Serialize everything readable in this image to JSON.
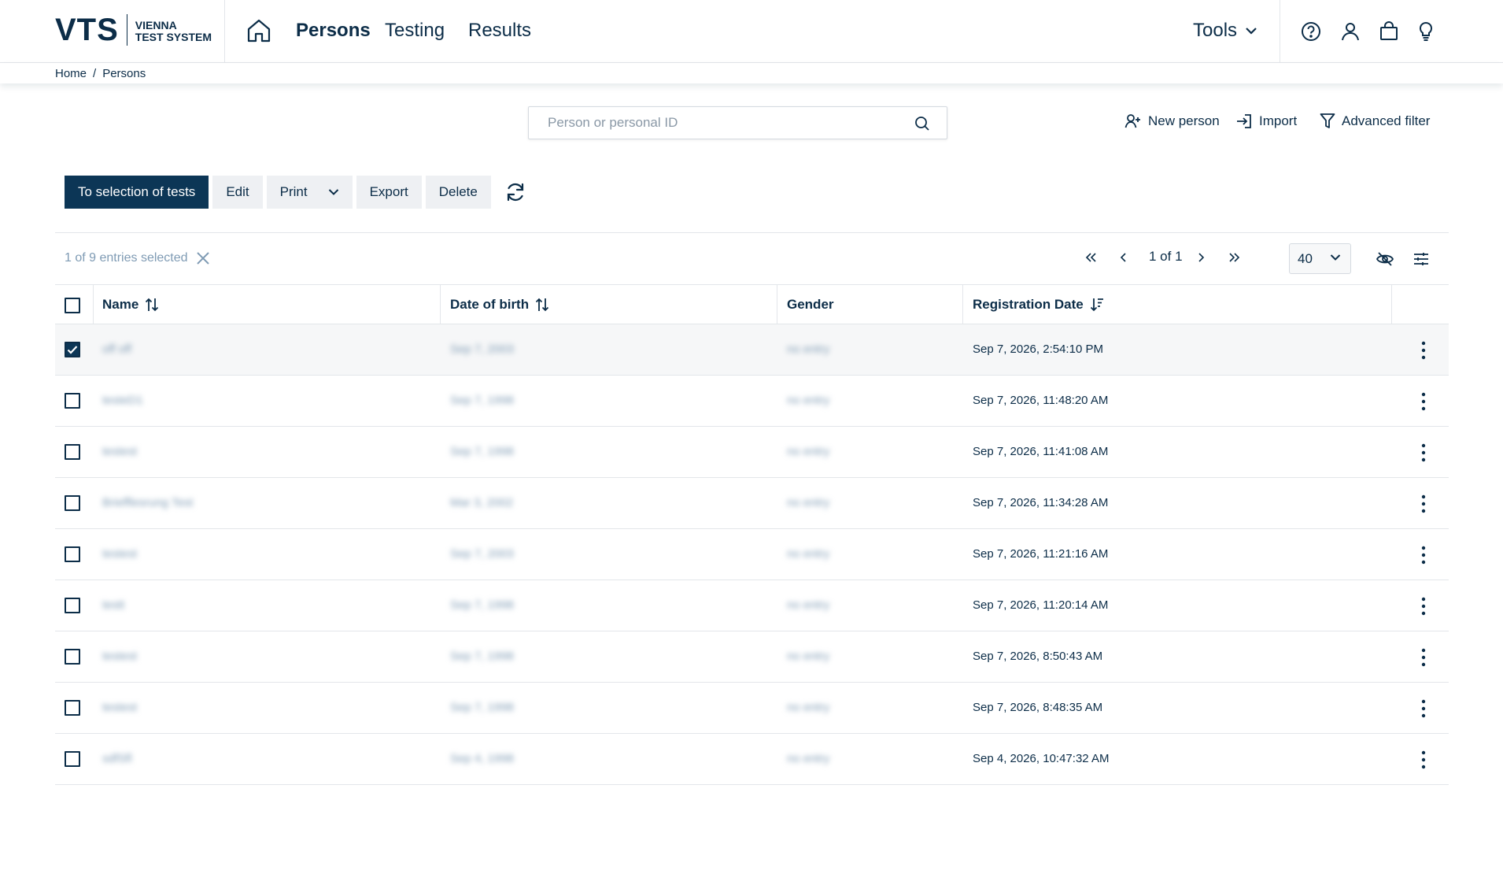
{
  "logo": {
    "mark": "VTS",
    "line1": "VIENNA",
    "line2": "TEST SYSTEM"
  },
  "nav": {
    "persons": "Persons",
    "testing": "Testing",
    "results": "Results",
    "tools": "Tools"
  },
  "breadcrumb": {
    "home": "Home",
    "sep": "/",
    "current": "Persons"
  },
  "search": {
    "placeholder": "Person or personal ID"
  },
  "actions": {
    "new_person": "New person",
    "import": "Import",
    "advanced_filter": "Advanced filter"
  },
  "toolbar": {
    "to_selection": "To selection of tests",
    "edit": "Edit",
    "print": "Print",
    "export": "Export",
    "delete": "Delete"
  },
  "selection": {
    "text": "1 of 9 entries selected"
  },
  "pager": {
    "text": "1 of 1",
    "page_size": "40"
  },
  "table": {
    "headers": {
      "name": "Name",
      "dob": "Date of birth",
      "gender": "Gender",
      "registration": "Registration Date"
    },
    "rows": [
      {
        "name": "off off",
        "dob": "Sep 7, 2003",
        "gender": "no entry",
        "registration": "Sep 7, 2026, 2:54:10 PM",
        "checked": true
      },
      {
        "name": "testeD1",
        "dob": "Sep 7, 1998",
        "gender": "no entry",
        "registration": "Sep 7, 2026, 11:48:20 AM",
        "checked": false
      },
      {
        "name": "testest",
        "dob": "Sep 7, 1998",
        "gender": "no entry",
        "registration": "Sep 7, 2026, 11:41:08 AM",
        "checked": false
      },
      {
        "name": "Briefflesrung Test",
        "dob": "Mar 3, 2002",
        "gender": "no entry",
        "registration": "Sep 7, 2026, 11:34:28 AM",
        "checked": false
      },
      {
        "name": "testest",
        "dob": "Sep 7, 2003",
        "gender": "no entry",
        "registration": "Sep 7, 2026, 11:21:16 AM",
        "checked": false
      },
      {
        "name": "testt",
        "dob": "Sep 7, 1998",
        "gender": "no entry",
        "registration": "Sep 7, 2026, 11:20:14 AM",
        "checked": false
      },
      {
        "name": "testest",
        "dob": "Sep 7, 1998",
        "gender": "no entry",
        "registration": "Sep 7, 2026, 8:50:43 AM",
        "checked": false
      },
      {
        "name": "testest",
        "dob": "Sep 7, 1998",
        "gender": "no entry",
        "registration": "Sep 7, 2026, 8:48:35 AM",
        "checked": false
      },
      {
        "name": "sdfSfl",
        "dob": "Sep 4, 1998",
        "gender": "no entry",
        "registration": "Sep 4, 2026, 10:47:32 AM",
        "checked": false
      }
    ]
  },
  "colors": {
    "primary": "#0c3656",
    "text": "#0c2d48",
    "muted": "#7f9bb4",
    "border": "#e3e6ea"
  }
}
